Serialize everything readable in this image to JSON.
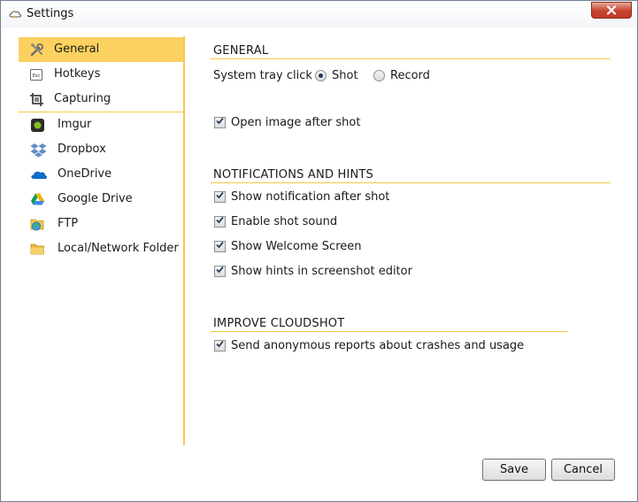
{
  "window": {
    "title": "Settings"
  },
  "sidebar": {
    "items": [
      {
        "label": "General",
        "icon": "tools-icon",
        "active": true
      },
      {
        "label": "Hotkeys",
        "icon": "esc-key-icon",
        "active": false
      },
      {
        "label": "Capturing",
        "icon": "crop-icon",
        "active": false
      },
      {
        "label": "Imgur",
        "icon": "imgur-icon",
        "active": false
      },
      {
        "label": "Dropbox",
        "icon": "dropbox-icon",
        "active": false
      },
      {
        "label": "OneDrive",
        "icon": "onedrive-icon",
        "active": false
      },
      {
        "label": "Google Drive",
        "icon": "google-drive-icon",
        "active": false
      },
      {
        "label": "FTP",
        "icon": "ftp-globe-icon",
        "active": false
      },
      {
        "label": "Local/Network Folder",
        "icon": "folder-icon",
        "active": false
      }
    ]
  },
  "general": {
    "title": "GENERAL",
    "tray_click_label": "System tray click",
    "tray_options": [
      {
        "label": "Shot",
        "selected": true
      },
      {
        "label": "Record",
        "selected": false
      }
    ],
    "open_image": {
      "label": "Open image after shot",
      "checked": true
    }
  },
  "notifications": {
    "title": "NOTIFICATIONS AND HINTS",
    "options": [
      {
        "label": "Show notification after shot",
        "checked": true
      },
      {
        "label": "Enable shot sound",
        "checked": true
      },
      {
        "label": "Show Welcome Screen",
        "checked": true
      },
      {
        "label": "Show hints in screenshot editor",
        "checked": true
      }
    ]
  },
  "improve": {
    "title": "IMPROVE CLOUDSHOT",
    "options": [
      {
        "label": "Send anonymous reports about crashes and usage",
        "checked": true
      }
    ]
  },
  "footer": {
    "save_label": "Save",
    "cancel_label": "Cancel"
  },
  "colors": {
    "accent": "#fcd160",
    "divider": "#f7c84a",
    "close": "#c7432c"
  }
}
